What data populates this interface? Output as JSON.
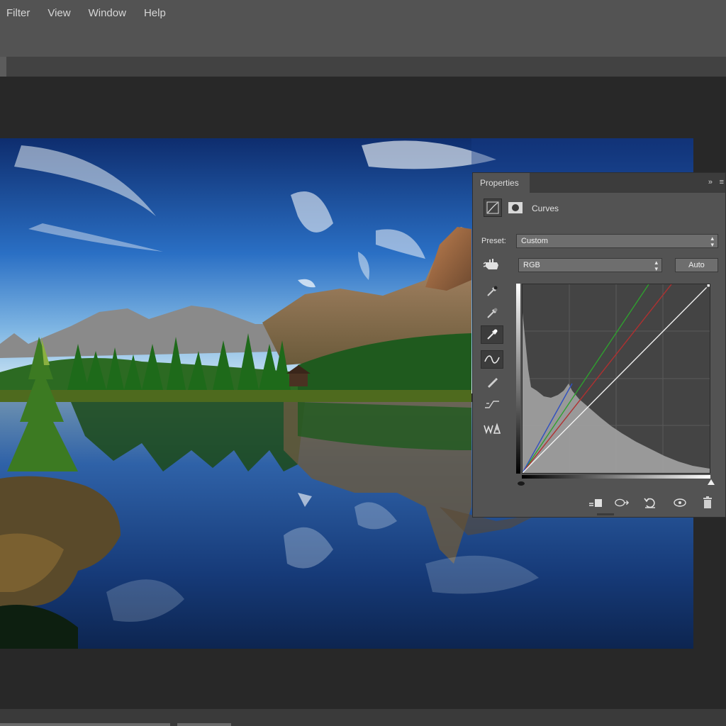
{
  "menu": {
    "items": [
      "Filter",
      "View",
      "Window",
      "Help"
    ]
  },
  "panel": {
    "tab_label": "Properties",
    "collapse_glyph": "»",
    "menu_glyph": "≡",
    "title": "Curves",
    "preset_label": "Preset:",
    "preset_value": "Custom",
    "channel_value": "RGB",
    "auto_label": "Auto",
    "tools": [
      "on-image-adjust-icon",
      "black-point-eyedropper-icon",
      "gray-point-eyedropper-icon",
      "white-point-eyedropper-icon",
      "curve-points-icon",
      "pencil-icon",
      "smooth-icon",
      "clipping-warning-icon"
    ],
    "footer_icons": [
      "clip-to-layer-icon",
      "view-previous-icon",
      "reset-icon",
      "visibility-icon",
      "trash-icon"
    ]
  },
  "colors": {
    "accent_red": "#b03030",
    "accent_green": "#2fa02f",
    "accent_blue": "#3050c0",
    "panel_bg": "#535353",
    "workspace_bg": "#282828"
  }
}
